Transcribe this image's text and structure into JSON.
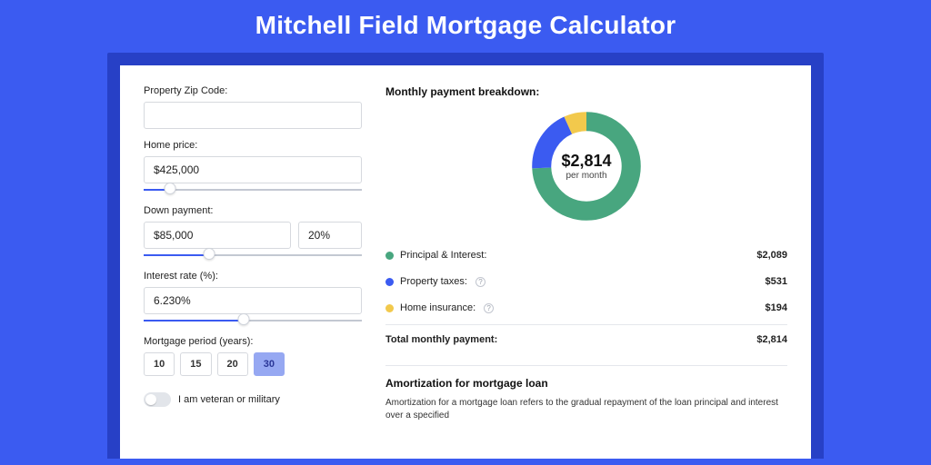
{
  "page": {
    "title": "Mitchell Field Mortgage Calculator"
  },
  "form": {
    "zip_label": "Property Zip Code:",
    "zip_value": "",
    "home_price_label": "Home price:",
    "home_price_value": "$425,000",
    "home_price_slider_pct": 12,
    "down_payment_label": "Down payment:",
    "down_payment_value": "$85,000",
    "down_payment_pct": "20%",
    "down_payment_slider_pct": 30,
    "rate_label": "Interest rate (%):",
    "rate_value": "6.230%",
    "rate_slider_pct": 46,
    "period_label": "Mortgage period (years):",
    "periods": [
      "10",
      "15",
      "20",
      "30"
    ],
    "period_selected": "30",
    "veteran_label": "I am veteran or military",
    "veteran_on": false
  },
  "breakdown": {
    "title": "Monthly payment breakdown:",
    "center_amount": "$2,814",
    "center_sub": "per month",
    "rows": [
      {
        "label": "Principal & Interest:",
        "value": "$2,089",
        "color": "#48a67f",
        "help": false
      },
      {
        "label": "Property taxes:",
        "value": "$531",
        "color": "#3b5bf1",
        "help": true
      },
      {
        "label": "Home insurance:",
        "value": "$194",
        "color": "#f2c94c",
        "help": true
      }
    ],
    "total_label": "Total monthly payment:",
    "total_value": "$2,814"
  },
  "chart_data": {
    "type": "pie",
    "title": "Monthly payment breakdown",
    "series": [
      {
        "name": "Principal & Interest",
        "value": 2089,
        "color": "#48a67f"
      },
      {
        "name": "Property taxes",
        "value": 531,
        "color": "#3b5bf1"
      },
      {
        "name": "Home insurance",
        "value": 194,
        "color": "#f2c94c"
      }
    ],
    "total": 2814,
    "center_label": "$2,814 per month"
  },
  "amort": {
    "title": "Amortization for mortgage loan",
    "body": "Amortization for a mortgage loan refers to the gradual repayment of the loan principal and interest over a specified"
  }
}
